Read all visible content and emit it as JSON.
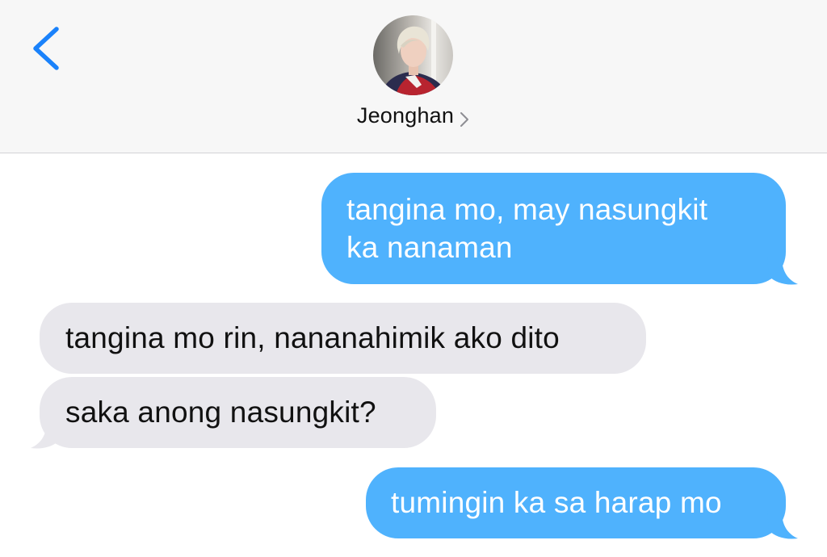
{
  "header": {
    "back_icon": "chevron-left-icon",
    "contact_name": "Jeonghan",
    "contact_chevron_icon": "chevron-right-icon",
    "accent_color": "#1a82fb"
  },
  "messages": [
    {
      "direction": "sent",
      "lines": [
        "tangina mo, may nasungkit",
        "ka nanaman"
      ]
    },
    {
      "direction": "received",
      "lines": [
        "tangina mo rin, nananahimik ako dito"
      ]
    },
    {
      "direction": "received",
      "lines": [
        "saka anong nasungkit?"
      ]
    },
    {
      "direction": "sent",
      "lines": [
        "tumingin ka sa harap mo"
      ]
    }
  ],
  "colors": {
    "sent_bubble": "#4fb2fd",
    "received_bubble": "#e8e7ec",
    "header_bg": "#f7f7f7"
  }
}
